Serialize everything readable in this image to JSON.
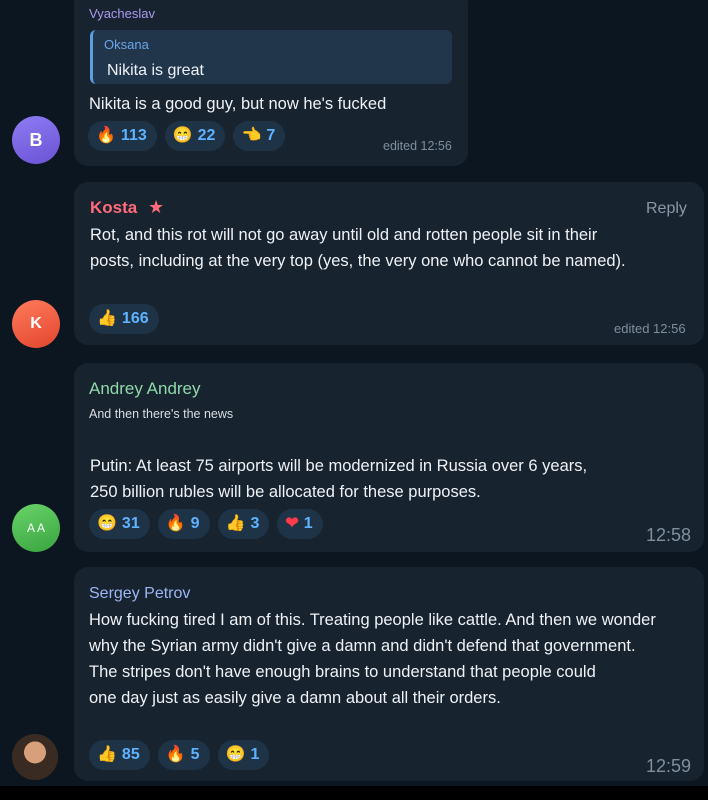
{
  "messages": [
    {
      "avatar": "B",
      "sender": "Vyacheslav",
      "quote": {
        "author": "Oksana",
        "text": "Nikita is great"
      },
      "text": "Nikita is a good guy, but now he's fucked",
      "reactions": [
        {
          "icon": "fire-icon",
          "emoji": "🔥",
          "count": "113"
        },
        {
          "icon": "grinning-face-icon",
          "emoji": "😁",
          "count": "22"
        },
        {
          "icon": "pointing-hand-icon",
          "emoji": "👈",
          "count": "7"
        }
      ],
      "time": "edited 12:56"
    },
    {
      "avatar": "K",
      "sender": "Kosta",
      "star": "★",
      "reply_label": "Reply",
      "text_lines": [
        "Rot, and this rot will not go away until old and rotten people sit in their",
        "posts, including at the very top (yes, the very one who cannot be named)."
      ],
      "reactions": [
        {
          "icon": "thumbs-up-icon",
          "emoji": "👍",
          "count": "166"
        }
      ],
      "time": "edited 12:56"
    },
    {
      "avatar": "A A",
      "sender": "Andrey Andrey",
      "subtitle": "And then there's the news",
      "text_lines": [
        "Putin: At least 75 airports will be modernized in Russia over 6 years,",
        "250 billion rubles will be allocated for these purposes."
      ],
      "reactions": [
        {
          "icon": "grinning-face-icon",
          "emoji": "😁",
          "count": "31"
        },
        {
          "icon": "fire-icon",
          "emoji": "🔥",
          "count": "9"
        },
        {
          "icon": "thumbs-up-icon",
          "emoji": "👍",
          "count": "3"
        },
        {
          "icon": "heart-icon",
          "emoji": "❤",
          "count": "1"
        }
      ],
      "time": "12:58"
    },
    {
      "avatar": "",
      "sender": "Sergey Petrov",
      "text_lines": [
        "How fucking tired I am of this. Treating people like cattle. And then we wonder",
        "why the Syrian army didn't give a damn and didn't defend that government.",
        "The stripes don't have enough brains to understand that people could",
        "one day just as easily give a damn about all their orders."
      ],
      "reactions": [
        {
          "icon": "thumbs-up-icon",
          "emoji": "👍",
          "count": "85"
        },
        {
          "icon": "fire-icon",
          "emoji": "🔥",
          "count": "5"
        },
        {
          "icon": "grinning-face-icon",
          "emoji": "😁",
          "count": "1"
        }
      ],
      "time": "12:59"
    }
  ],
  "colors": {
    "background": "#0c1620",
    "bubble": "#17232f",
    "reaction_bg": "#1f3346",
    "reaction_text": "#5fb2ff",
    "vyacheslav": "#a99af0",
    "kosta": "#ff6b7a",
    "andrey": "#8fd9a8",
    "sergey": "#9db6f5"
  }
}
